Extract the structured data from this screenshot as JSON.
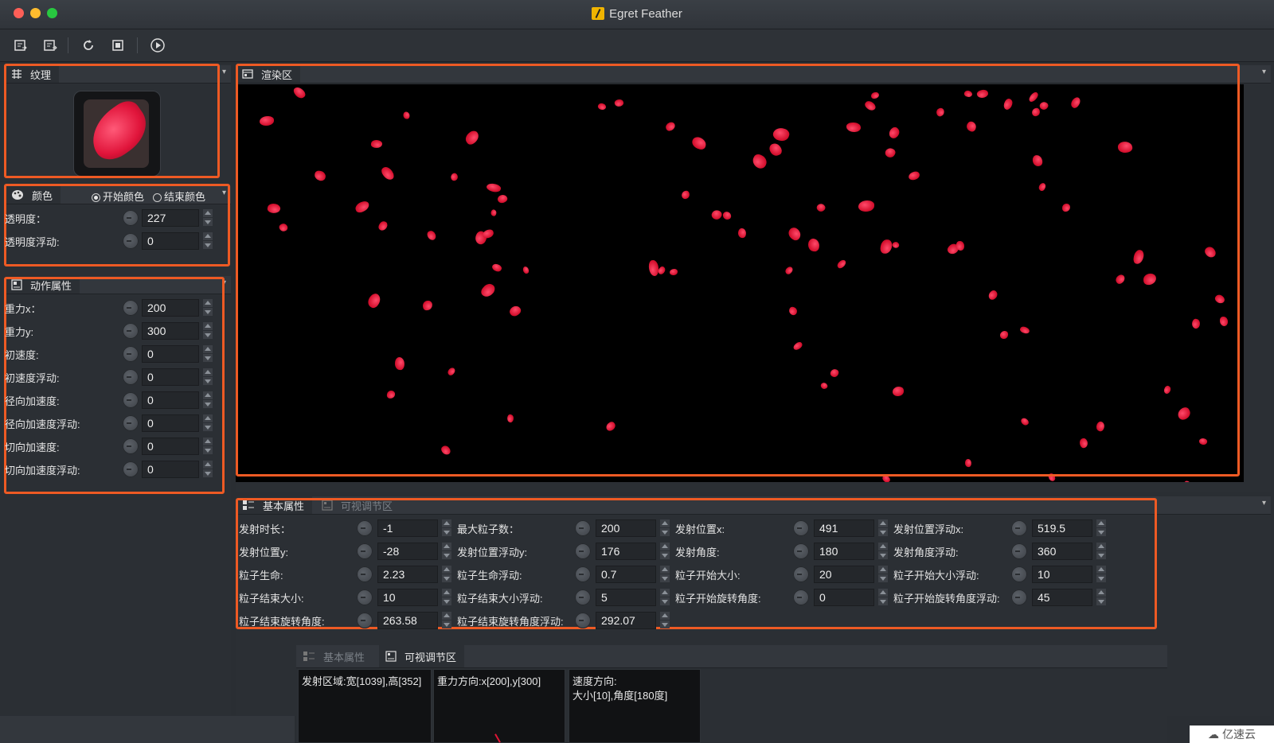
{
  "app": {
    "title": "Egret Feather"
  },
  "toolbar": {
    "buttons": [
      "new-file-icon",
      "open-file-icon",
      "refresh-icon",
      "stop-icon",
      "play-icon"
    ]
  },
  "texture": {
    "tab": "纹理"
  },
  "color": {
    "tab": "颜色",
    "start_label": "开始颜色",
    "end_label": "结束颜色",
    "selected": "开始颜色",
    "fields": [
      {
        "label": "透明度：",
        "value": "227"
      },
      {
        "label": "透明度浮动:",
        "value": "0"
      }
    ]
  },
  "action": {
    "tab": "动作属性",
    "fields": [
      {
        "label": "重力x：",
        "value": "200"
      },
      {
        "label": "重力y:",
        "value": "300"
      },
      {
        "label": "初速度:",
        "value": "0"
      },
      {
        "label": "初速度浮动:",
        "value": "0"
      },
      {
        "label": "径向加速度:",
        "value": "0"
      },
      {
        "label": "径向加速度浮动:",
        "value": "0"
      },
      {
        "label": "切向加速度:",
        "value": "0"
      },
      {
        "label": "切向加速度浮动:",
        "value": "0"
      }
    ]
  },
  "render": {
    "tab": "渲染区"
  },
  "basic": {
    "tab_basic": "基本属性",
    "tab_visual": "可视调节区",
    "fields": [
      {
        "label": "发射时长：",
        "value": "-1"
      },
      {
        "label": "最大粒子数：",
        "value": "200"
      },
      {
        "label": "发射位置x:",
        "value": "491"
      },
      {
        "label": "发射位置浮动x:",
        "value": "519.5"
      },
      {
        "label": "发射位置y:",
        "value": "-28"
      },
      {
        "label": "发射位置浮动y:",
        "value": "176"
      },
      {
        "label": "发射角度:",
        "value": "180"
      },
      {
        "label": "发射角度浮动:",
        "value": "360"
      },
      {
        "label": "粒子生命:",
        "value": "2.23"
      },
      {
        "label": "粒子生命浮动:",
        "value": "0.7"
      },
      {
        "label": "粒子开始大小:",
        "value": "20"
      },
      {
        "label": "粒子开始大小浮动:",
        "value": "10"
      },
      {
        "label": "粒子结束大小:",
        "value": "10"
      },
      {
        "label": "粒子结束大小浮动:",
        "value": "5"
      },
      {
        "label": "粒子开始旋转角度:",
        "value": "0"
      },
      {
        "label": "粒子开始旋转角度浮动:",
        "value": "45"
      },
      {
        "label": "粒子结束旋转角度:",
        "value": "263.58"
      },
      {
        "label": "粒子结束旋转角度浮动:",
        "value": "292.07"
      }
    ]
  },
  "visual": {
    "tab_basic": "基本属性",
    "tab_visual": "可视调节区",
    "boxes": [
      "发射区域:宽[1039],高[352]",
      "重力方向:x[200],y[300]",
      "速度方向:\n大小[10],角度[180度]"
    ]
  },
  "watermark": {
    "text": "亿速云"
  },
  "colors": {
    "highlight": "#ee5a24",
    "petal": "#e01535"
  }
}
